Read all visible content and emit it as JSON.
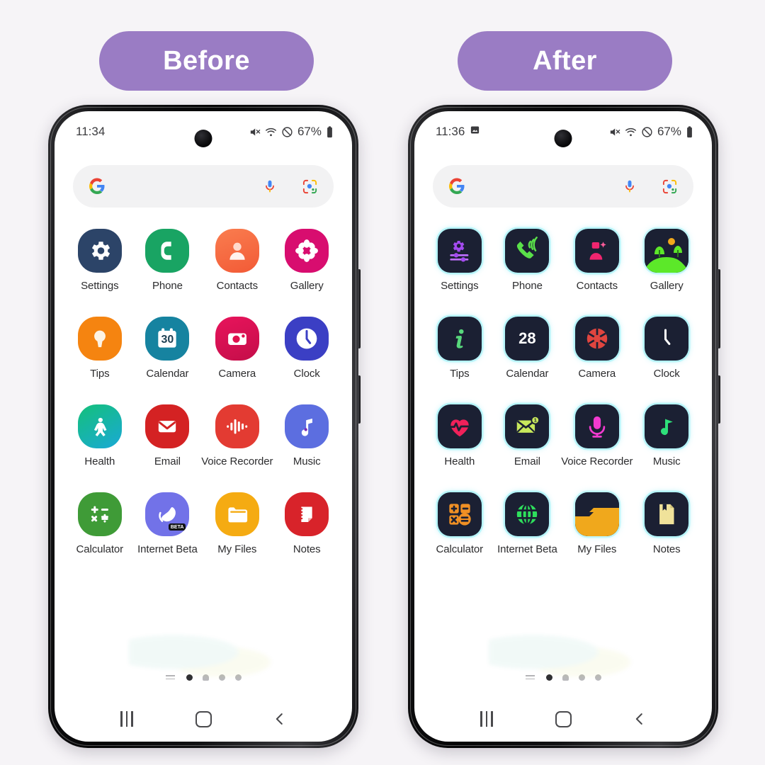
{
  "background_color": "#f6f4f7",
  "badges": {
    "before": "Before",
    "after": "After",
    "color": "#9a7cc4",
    "text_color": "#ffffff"
  },
  "phones": [
    {
      "variant": "before",
      "status_bar": {
        "time": "11:34",
        "has_screenshot_icon": false,
        "battery_percent": "67%",
        "icons": [
          "mute-icon",
          "wifi-icon",
          "dnd-icon",
          "battery-icon"
        ]
      },
      "search": {
        "google_logo": "google-g-icon",
        "placeholder": "",
        "value": "",
        "mic_icon": "microphone-icon",
        "lens_icon": "google-lens-icon"
      },
      "apps": [
        {
          "label": "Settings",
          "icon": "settings-gear-icon",
          "bg": "#2c4468",
          "fg": "#ffffff"
        },
        {
          "label": "Phone",
          "icon": "phone-handset-icon",
          "bg": "#19a463",
          "fg": "#ffffff"
        },
        {
          "label": "Contacts",
          "icon": "person-icon",
          "bg": "#f7704a",
          "fg": "#ffe6de"
        },
        {
          "label": "Gallery",
          "icon": "flower-icon",
          "bg": "#d80d6f",
          "fg": "#ffffff"
        },
        {
          "label": "Tips",
          "icon": "lightbulb-icon",
          "bg": "#f58410",
          "fg": "#fdf3e4"
        },
        {
          "label": "Calendar",
          "icon": "calendar-icon",
          "bg": "#1683a0",
          "fg": "#ffffff",
          "day": "30"
        },
        {
          "label": "Camera",
          "icon": "camera-icon",
          "bg": "#e0114e",
          "fg": "#ffffff"
        },
        {
          "label": "Clock",
          "icon": "clock-icon",
          "bg": "#3b3fc4",
          "fg": "#ffffff"
        },
        {
          "label": "Health",
          "icon": "health-person-icon",
          "bg": "#16b866",
          "fg": "#ffffff"
        },
        {
          "label": "Email",
          "icon": "envelope-icon",
          "bg": "#d42223",
          "fg": "#ffffff"
        },
        {
          "label": "Voice Recorder",
          "icon": "waveform-icon",
          "bg": "#e33b32",
          "fg": "#ffffff"
        },
        {
          "label": "Music",
          "icon": "music-note-icon",
          "bg": "#5c6ee0",
          "fg": "#ffffff"
        },
        {
          "label": "Calculator",
          "icon": "calculator-icon",
          "bg": "#3f9b37",
          "fg": "#ffffff"
        },
        {
          "label": "Internet Beta",
          "icon": "internet-beta-icon",
          "bg": "#7272e8",
          "fg": "#ffffff",
          "tag": "BETA"
        },
        {
          "label": "My Files",
          "icon": "folder-icon",
          "bg": "#f5ab12",
          "fg": "#ffffff"
        },
        {
          "label": "Notes",
          "icon": "notes-icon",
          "bg": "#d8232a",
          "fg": "#ffffff"
        }
      ],
      "page_indicator": {
        "count": 4,
        "active": 1,
        "apps_button": "apps-list-icon"
      },
      "nav_bar": {
        "recents": "recents-icon",
        "home": "home-icon",
        "back": "back-icon"
      }
    },
    {
      "variant": "after",
      "status_bar": {
        "time": "11:36",
        "has_screenshot_icon": true,
        "battery_percent": "67%",
        "icons": [
          "screenshot-icon",
          "mute-icon",
          "wifi-icon",
          "dnd-icon",
          "battery-icon"
        ]
      },
      "search": {
        "google_logo": "google-g-icon",
        "placeholder": "",
        "value": "",
        "mic_icon": "microphone-icon",
        "lens_icon": "google-lens-icon"
      },
      "apps": [
        {
          "label": "Settings",
          "icon": "settings-sliders-icon",
          "bg": "#1b2033",
          "fg": "#a44bf0"
        },
        {
          "label": "Phone",
          "icon": "phone-ringing-icon",
          "bg": "#1b2033",
          "fg": "#5ae04a"
        },
        {
          "label": "Contacts",
          "icon": "person-add-icon",
          "bg": "#1b2033",
          "fg": "#f0256f"
        },
        {
          "label": "Gallery",
          "icon": "landscape-icon",
          "bg": "#1b2033",
          "fg": "#5ce829"
        },
        {
          "label": "Tips",
          "icon": "info-icon",
          "bg": "#1b2033",
          "fg": "#58d87c"
        },
        {
          "label": "Calendar",
          "icon": "calendar-icon",
          "bg": "#1b2033",
          "fg": "#ffffff",
          "day": "28"
        },
        {
          "label": "Camera",
          "icon": "aperture-icon",
          "bg": "#1b2033",
          "fg": "#e0453f"
        },
        {
          "label": "Clock",
          "icon": "clock-icon",
          "bg": "#1b2033",
          "fg": "#ffffff"
        },
        {
          "label": "Health",
          "icon": "heart-pulse-icon",
          "bg": "#1b2033",
          "fg": "#f0215a"
        },
        {
          "label": "Email",
          "icon": "envelope-badge-icon",
          "bg": "#1b2033",
          "fg": "#c8e85c"
        },
        {
          "label": "Voice Recorder",
          "icon": "microphone-icon",
          "bg": "#1b2033",
          "fg": "#f23ad0"
        },
        {
          "label": "Music",
          "icon": "music-note-icon",
          "bg": "#1b2033",
          "fg": "#2ee07a"
        },
        {
          "label": "Calculator",
          "icon": "calculator-icon",
          "bg": "#1b2033",
          "fg": "#f09024"
        },
        {
          "label": "Internet Beta",
          "icon": "globe-icon",
          "bg": "#1b2033",
          "fg": "#2ee05c"
        },
        {
          "label": "My Files",
          "icon": "folder-icon",
          "bg": "#1b2033",
          "fg": "#f0a81c"
        },
        {
          "label": "Notes",
          "icon": "note-bookmark-icon",
          "bg": "#1b2033",
          "fg": "#f0e29a"
        }
      ],
      "page_indicator": {
        "count": 4,
        "active": 1,
        "apps_button": "apps-list-icon"
      },
      "nav_bar": {
        "recents": "recents-icon",
        "home": "home-icon",
        "back": "back-icon"
      }
    }
  ]
}
